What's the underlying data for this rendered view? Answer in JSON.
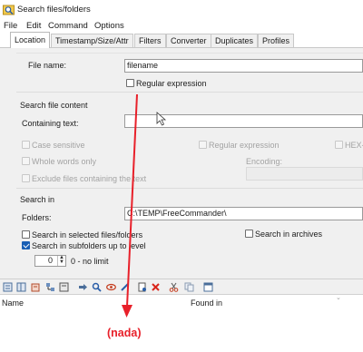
{
  "window": {
    "title": "Search files/folders"
  },
  "menu": {
    "file": "File",
    "edit": "Edit",
    "command": "Command",
    "options": "Options"
  },
  "tabs": [
    "Location",
    "Timestamp/Size/Attr",
    "Filters",
    "Converter",
    "Duplicates",
    "Profiles"
  ],
  "location": {
    "file_name_label": "File name:",
    "file_name_value": "filename",
    "regex_label": "Regular expression"
  },
  "content": {
    "section_title": "Search file content",
    "containing_label": "Containing text:",
    "containing_value": "",
    "case_sensitive": "Case sensitive",
    "regex": "Regular expression",
    "hex": "HEX-",
    "whole_words": "Whole words only",
    "encoding_label": "Encoding:",
    "exclude": "Exclude files containing the text"
  },
  "search_in": {
    "section_title": "Search in",
    "folders_label": "Folders:",
    "folders_value": "C:\\TEMP\\FreeCommander\\",
    "selected_files": "Search in selected files/folders",
    "archives": "Search in archives",
    "subfolders": "Search in subfolders up to level",
    "level_value": "0",
    "level_note": "0 - no limit"
  },
  "results": {
    "col_name": "Name",
    "col_found_in": "Found in",
    "annotation": "(nada)"
  },
  "colors": {
    "accent": "#1a5fb4",
    "annotation": "#e8202a",
    "panel": "#f0f0f0"
  }
}
